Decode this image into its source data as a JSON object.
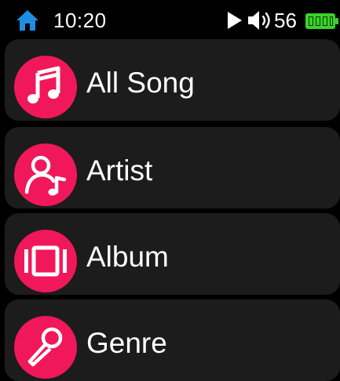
{
  "status_bar": {
    "time": "10:20",
    "volume": "56",
    "icons": [
      "home-icon",
      "play-icon",
      "volume-icon",
      "battery-icon"
    ]
  },
  "menu": {
    "items": [
      {
        "label": "All Song",
        "icon": "music-note-icon"
      },
      {
        "label": "Artist",
        "icon": "artist-icon"
      },
      {
        "label": "Album",
        "icon": "album-icon"
      },
      {
        "label": "Genre",
        "icon": "microphone-icon"
      }
    ]
  },
  "colors": {
    "accent": "#f0185a",
    "home": "#1e8fe0",
    "battery": "#3bd12b",
    "item_background": "#1c1c1c",
    "background": "#000000"
  }
}
